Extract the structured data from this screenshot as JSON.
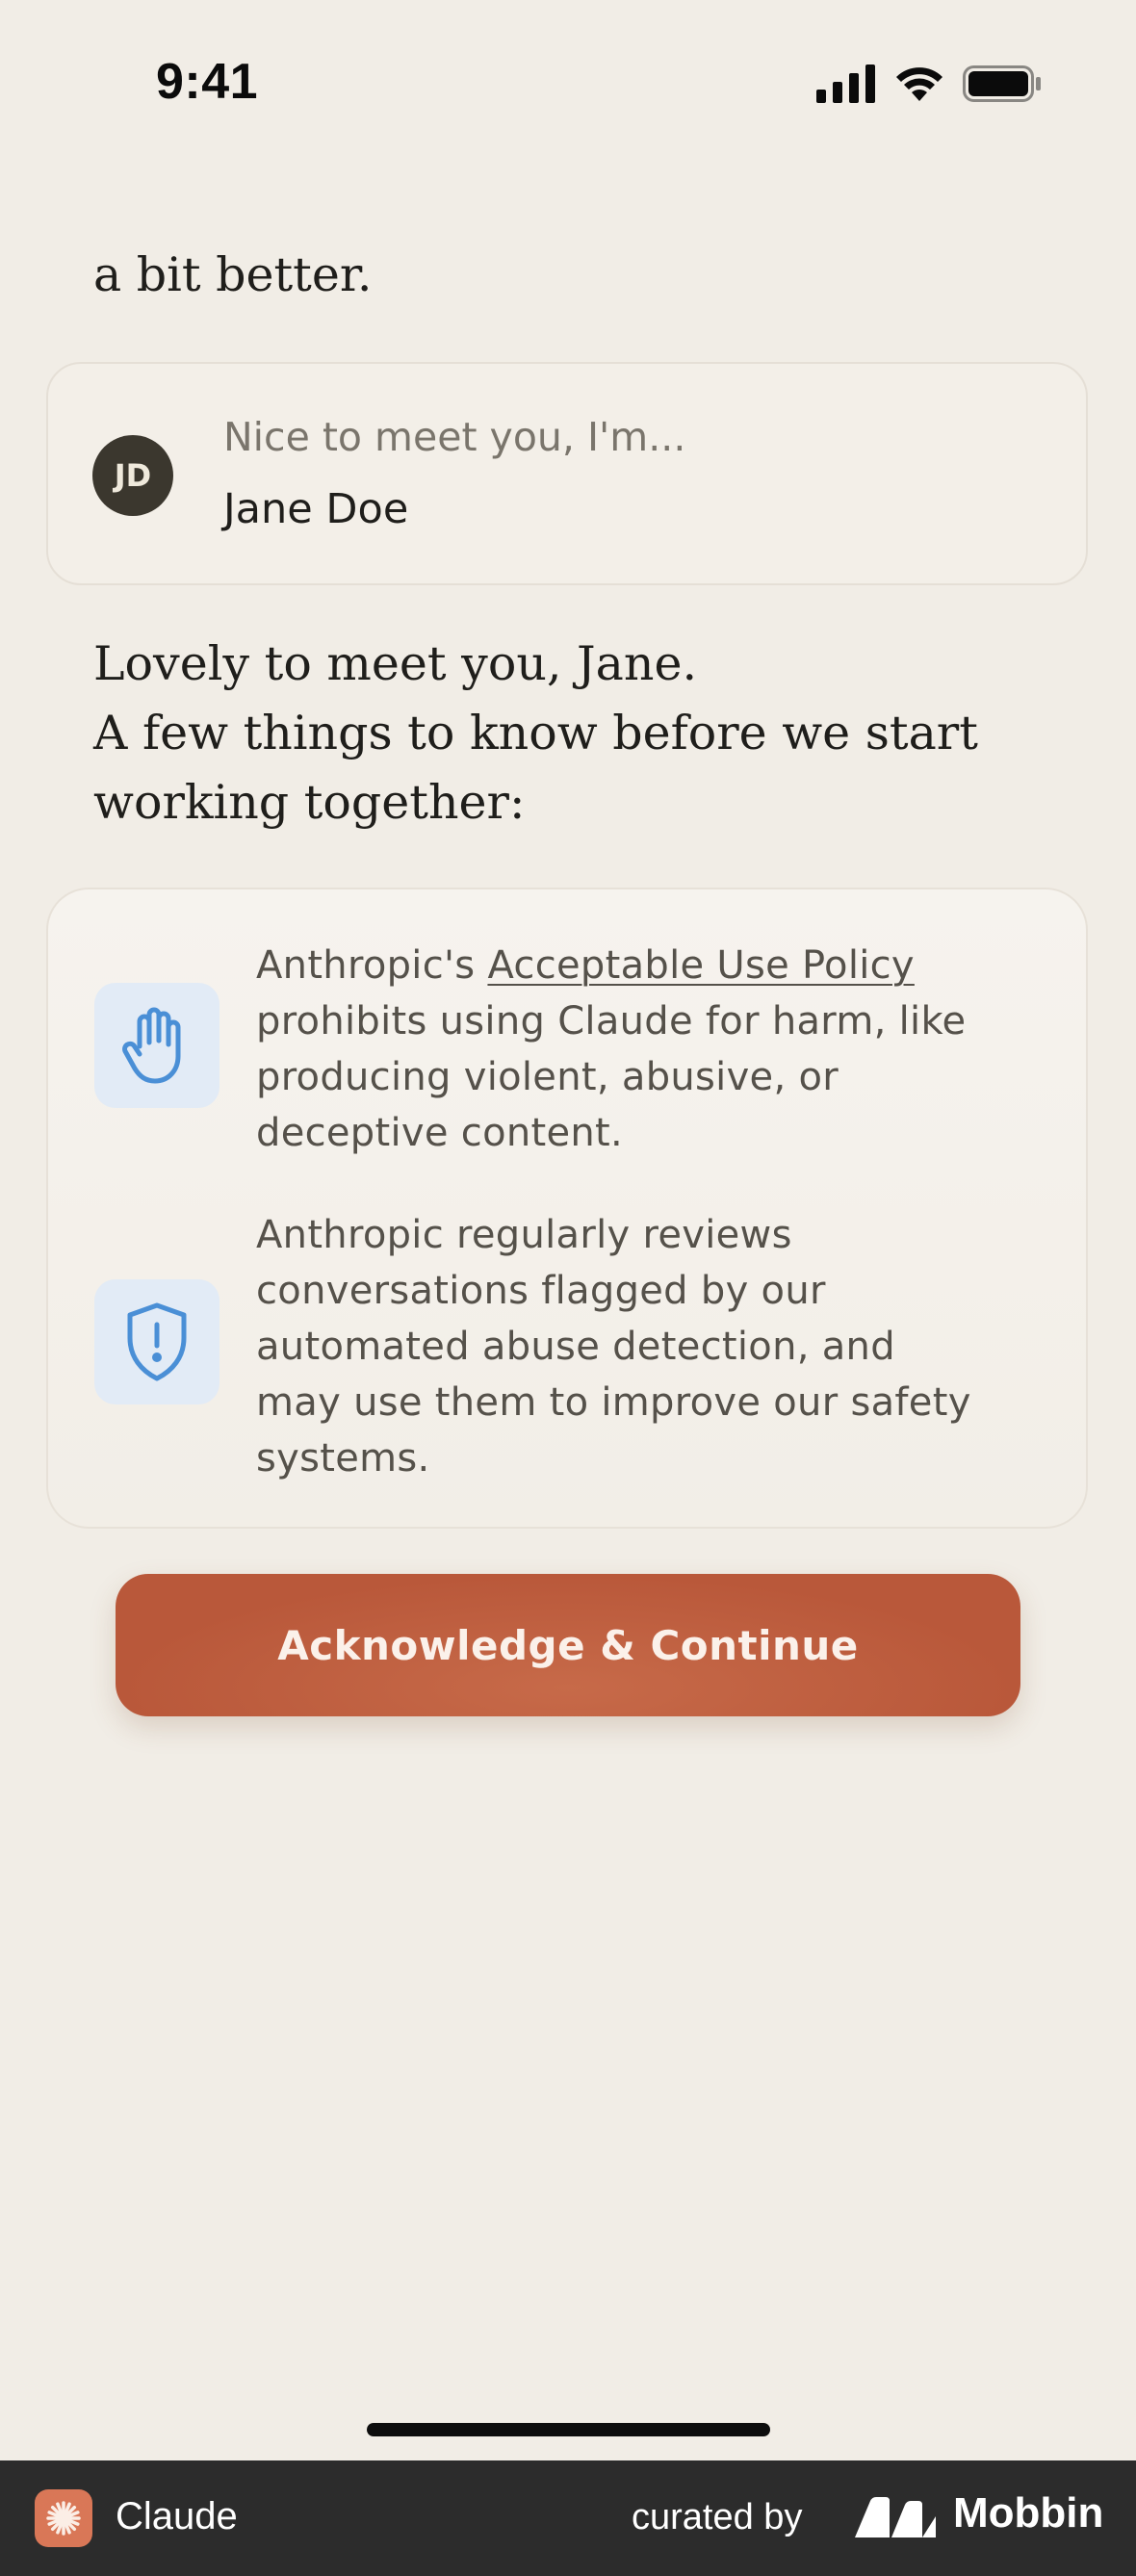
{
  "status_bar": {
    "time": "9:41",
    "icons": [
      "cellular-signal-icon",
      "wifi-icon",
      "battery-icon"
    ]
  },
  "chat": {
    "previous_message_tail": "a bit better.",
    "name_card": {
      "avatar_initials": "JD",
      "prompt": "Nice to meet you, I'm...",
      "name": "Jane Doe"
    },
    "reply_lines": [
      "Lovely to meet you, Jane.",
      "A few things to know before we start",
      "working together:"
    ]
  },
  "info_card": {
    "items": [
      {
        "icon": "raised-hand-icon",
        "prefix": "Anthropic's ",
        "link_text": "Acceptable Use Policy",
        "lines": [
          "prohibits using Claude for harm, like",
          "producing violent, abusive, or",
          "deceptive content."
        ]
      },
      {
        "icon": "shield-alert-icon",
        "lines": [
          "Anthropic regularly reviews",
          "conversations flagged by our",
          "automated abuse detection, and",
          "may use them to improve our safety",
          "systems."
        ]
      }
    ]
  },
  "cta": {
    "label": "Acknowledge & Continue"
  },
  "footer": {
    "app_name": "Claude",
    "curated_by": "curated by",
    "brand": "Mobbin"
  },
  "colors": {
    "background": "#f1ede6",
    "accent": "#bd5d3e",
    "icon_tile": "#e2ebf6",
    "icon_stroke": "#4a8fd6",
    "footer": "#2c2c2c"
  }
}
